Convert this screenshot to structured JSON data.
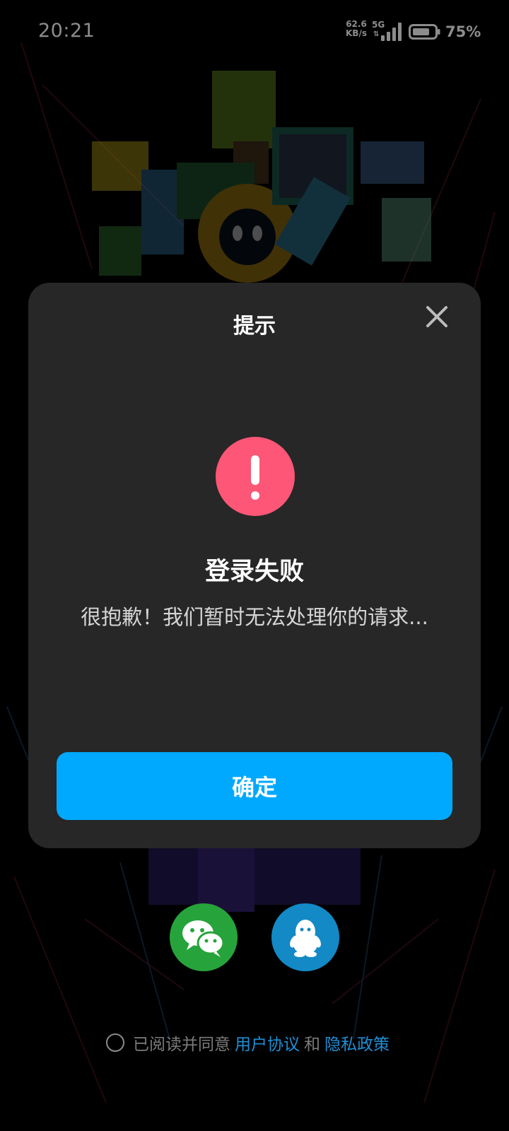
{
  "status_bar": {
    "time": "20:21",
    "net_speed_value": "62.6",
    "net_speed_unit": "KB/s",
    "network_type": "5G",
    "battery_percent": "75%",
    "icons": [
      "signal-icon",
      "battery-icon"
    ]
  },
  "dialog": {
    "title": "提示",
    "close_icon": "close-icon",
    "alert_icon": "exclamation-icon",
    "heading": "登录失败",
    "message": "很抱歉！我们暂时无法处理你的请求...",
    "confirm_label": "确定"
  },
  "social_login": {
    "wechat_icon": "wechat-icon",
    "qq_icon": "qq-icon"
  },
  "agreement": {
    "prefix": "已阅读并同意",
    "user_agreement": "用户协议",
    "conjunction": "和",
    "privacy_policy": "隐私政策"
  },
  "colors": {
    "dialog_bg": "#272727",
    "alert_red": "#fd5677",
    "confirm_blue": "#00a9fe",
    "wechat_green": "#27a33b",
    "qq_blue": "#1389c6",
    "link_blue": "#1e8fd6"
  }
}
